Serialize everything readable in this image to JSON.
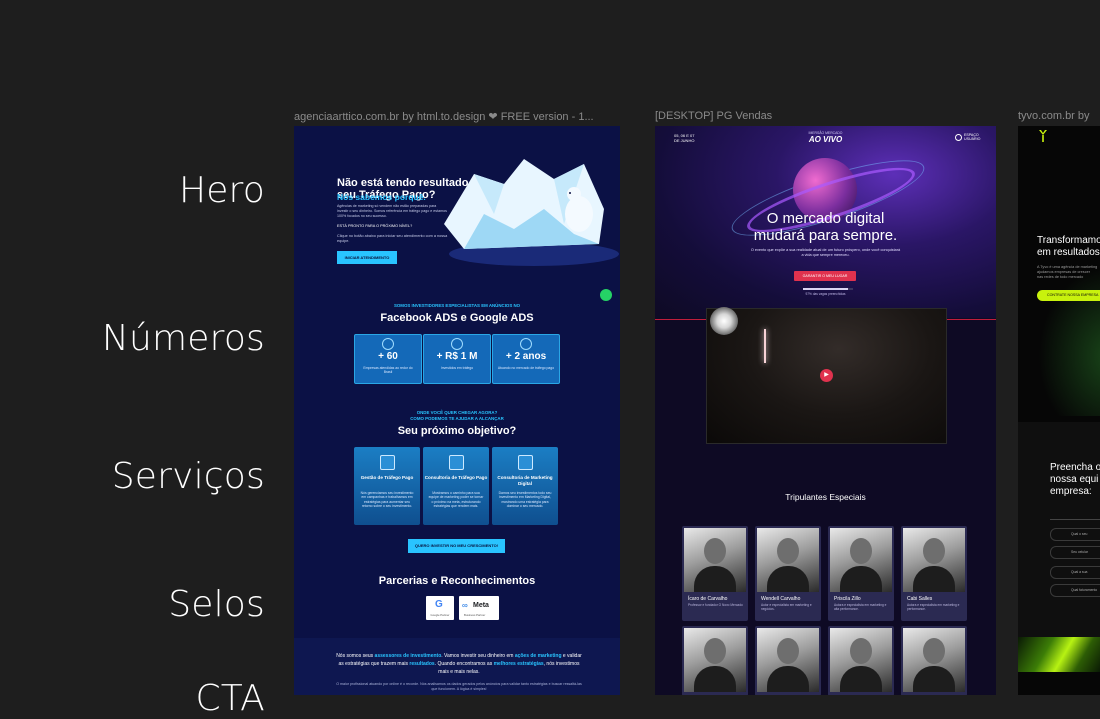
{
  "sections": {
    "hero": "Hero",
    "numeros": "Números",
    "servicos": "Serviços",
    "selos": "Selos",
    "cta": "CTA"
  },
  "frames": [
    {
      "title": "agenciaarttico.com.br by html.to.design ❤ FREE version - 1..."
    },
    {
      "title": "[DESKTOP] PG Vendas"
    },
    {
      "title": "tyvo.com.br by"
    }
  ],
  "arttico": {
    "hero_title": "Não está tendo resultado com seu Tráfego Pago?",
    "hero_accent": "Nós sabemos porquê.",
    "hero_body": "Agências de marketing só vendem não estão preparadas para investir o seu dinheiro. Somos referência em tráfego pago e estamos 100% focados no seu sucesso.",
    "hero_question": "ESTÁ PRONTO PARA O PRÓXIMO NÍVEL?",
    "hero_cta_text": "Clique no botão abaixo para iniciar seu atendimento com a nossa equipe.",
    "hero_button": "INICIAR ATENDIMENTO",
    "numbers_sub": "SOMOS INVESTIDORES ESPECIALISTAS EM ANÚNCIOS NO",
    "numbers_title": "Facebook ADS e Google ADS",
    "stats": [
      {
        "value": "+ 60",
        "label": "Empresas atendidas ao redor do Brasil"
      },
      {
        "value": "+ R$ 1 M",
        "label": "Investidos em tráfego"
      },
      {
        "value": "+ 2 anos",
        "label": "Atuando no mercado de tráfego pago"
      }
    ],
    "services_sub1": "ONDE VOCÊ QUER CHEGAR AGORA?",
    "services_sub2": "COMO PODEMOS TE AJUDAR A ALCANÇAR",
    "services_title": "Seu próximo objetivo?",
    "services": [
      {
        "title": "Gestão de Tráfego Pago",
        "desc": "Nós gerenciamos seu investimento em campanhas e trabalhamos em estratégias para aumentar seu retorno sobre o seu investimento."
      },
      {
        "title": "Consultoria de Tráfego Pago",
        "desc": "Mostramos o caminho para sua equipe de marketing poder se tornar o próximo na meta, estruturando estratégias que rendem mais."
      },
      {
        "title": "Consultoria de Marketing Digital",
        "desc": "Damos seu investimentos todo seu investimento em Marketing Digital, mostrando uma estratégia para dominar o seu mercado."
      }
    ],
    "services_button": "QUERO INVESTIR NO MEU CRESCIMENTO!",
    "seals_title": "Parcerias e Reconhecimentos",
    "seal_google": "Google Partner",
    "seal_meta": "Meta",
    "seal_meta_sub": "Business Partner",
    "cta_text_1": "Nós somos seus ",
    "cta_hl_1": "assessores de investimento",
    "cta_text_2": ". Vamos investir seu dinheiro em ",
    "cta_hl_2": "ações de marketing",
    "cta_text_3": " e validar as estratégias que trazem mais ",
    "cta_hl_3": "resultados",
    "cta_text_4": ". Quando encontramos as ",
    "cta_hl_4": "melhores estratégias",
    "cta_text_5": ", nós investimos mais e mais nelas.",
    "cta_small": "O maior profissional atuando por online é o recorde. Nós analisamos os dados gerados pelos anúncios para validar tanto estratégias e buscar ressaltá-las que funcionem. A lógica é simples!"
  },
  "vendas": {
    "date_1": "05, 06 E 07",
    "date_2": "DE JUNHO",
    "logo_top": "IMERSÃO MERCADO",
    "logo": "AO VIVO",
    "area_1": "ESPAÇO",
    "area_2": "USUÁRIO",
    "title_1": "O mercado digital",
    "title_2": "mudará para sempre.",
    "desc": "O evento que expõe a sua realidade atual de um futuro próspero, onde você conquistará a vida que sempre mereceu.",
    "cta": "GARANTIR O MEU LUGAR",
    "progress": 0.9,
    "progress_text": "97% das vagas preenchidas",
    "section_title": "Tripulantes Especiais",
    "speakers": [
      {
        "name": "Ícaro de Carvalho",
        "desc": "Professor e fundador O Novo Mercado"
      },
      {
        "name": "Wendell Carvalho",
        "desc": "Autor e especialista em marketing e negócios."
      },
      {
        "name": "Priscila Zillo",
        "desc": "Autora e especialista em marketing e alta performance."
      },
      {
        "name": "Cabi Salles",
        "desc": "Autora e especialista em marketing e performance."
      }
    ]
  },
  "tyvo": {
    "hero_1": "Transformamos",
    "hero_2": "em resultados",
    "small_1": "A Tyvo é uma agência de marketing",
    "small_2": "ajudamos empresas de crescer",
    "small_3": "nas redes de todo mercado",
    "button": "CONTRATE NOSSA EMPRESA",
    "form_1": "Preencha o",
    "form_2": "nossa equi",
    "form_3": "empresa:",
    "options": [
      "Qual o seu",
      "Seu celular",
      "Qual a sua",
      "Qual faturamento"
    ]
  },
  "colors": {
    "arttico_bg": "#0b1145",
    "arttico_accent": "#29c4ff",
    "vendas_cta": "#e0324e",
    "tyvo_accent": "#c8f20d"
  }
}
